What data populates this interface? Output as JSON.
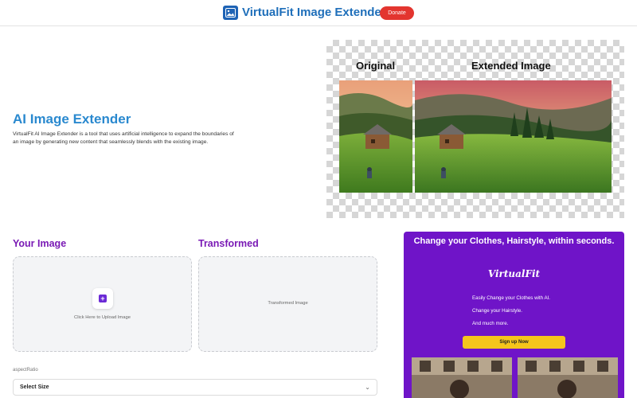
{
  "header": {
    "brand": "VirtualFit Image Extender",
    "donate_label": "Donate",
    "logo_icon": "image-icon"
  },
  "hero": {
    "title": "AI Image Extender",
    "description": "VirtualFit AI Image Extender is a tool that uses artificial intelligence to expand the boundaries of an image by generating new content that seamlessly blends with the existing image.",
    "label_original": "Original",
    "label_extended": "Extended Image"
  },
  "upload": {
    "heading_your": "Your Image",
    "heading_transformed": "Transformed",
    "upload_text": "Click Here to Upload Image",
    "transformed_text": "Transformed Image",
    "upload_icon": "plus-icon",
    "aspect_label": "aspectRatio",
    "select_value": "Select Size",
    "select_icon": "chevron-down-icon"
  },
  "promo": {
    "title": "Change your Clothes, Hairstyle, within seconds.",
    "brand": "VirtualFit",
    "line1": "Easily Change your Clothes with AI.",
    "line2": "Change your Hairstyle.",
    "line3": "And much more.",
    "signup_label": "Sign up Now"
  },
  "colors": {
    "brand_blue": "#1f6fba",
    "hero_title": "#2a89cf",
    "donate_red": "#e3352f",
    "section_purple": "#7a1ab5",
    "promo_bg": "#6f14c8",
    "signup_yellow": "#f5c51c"
  }
}
